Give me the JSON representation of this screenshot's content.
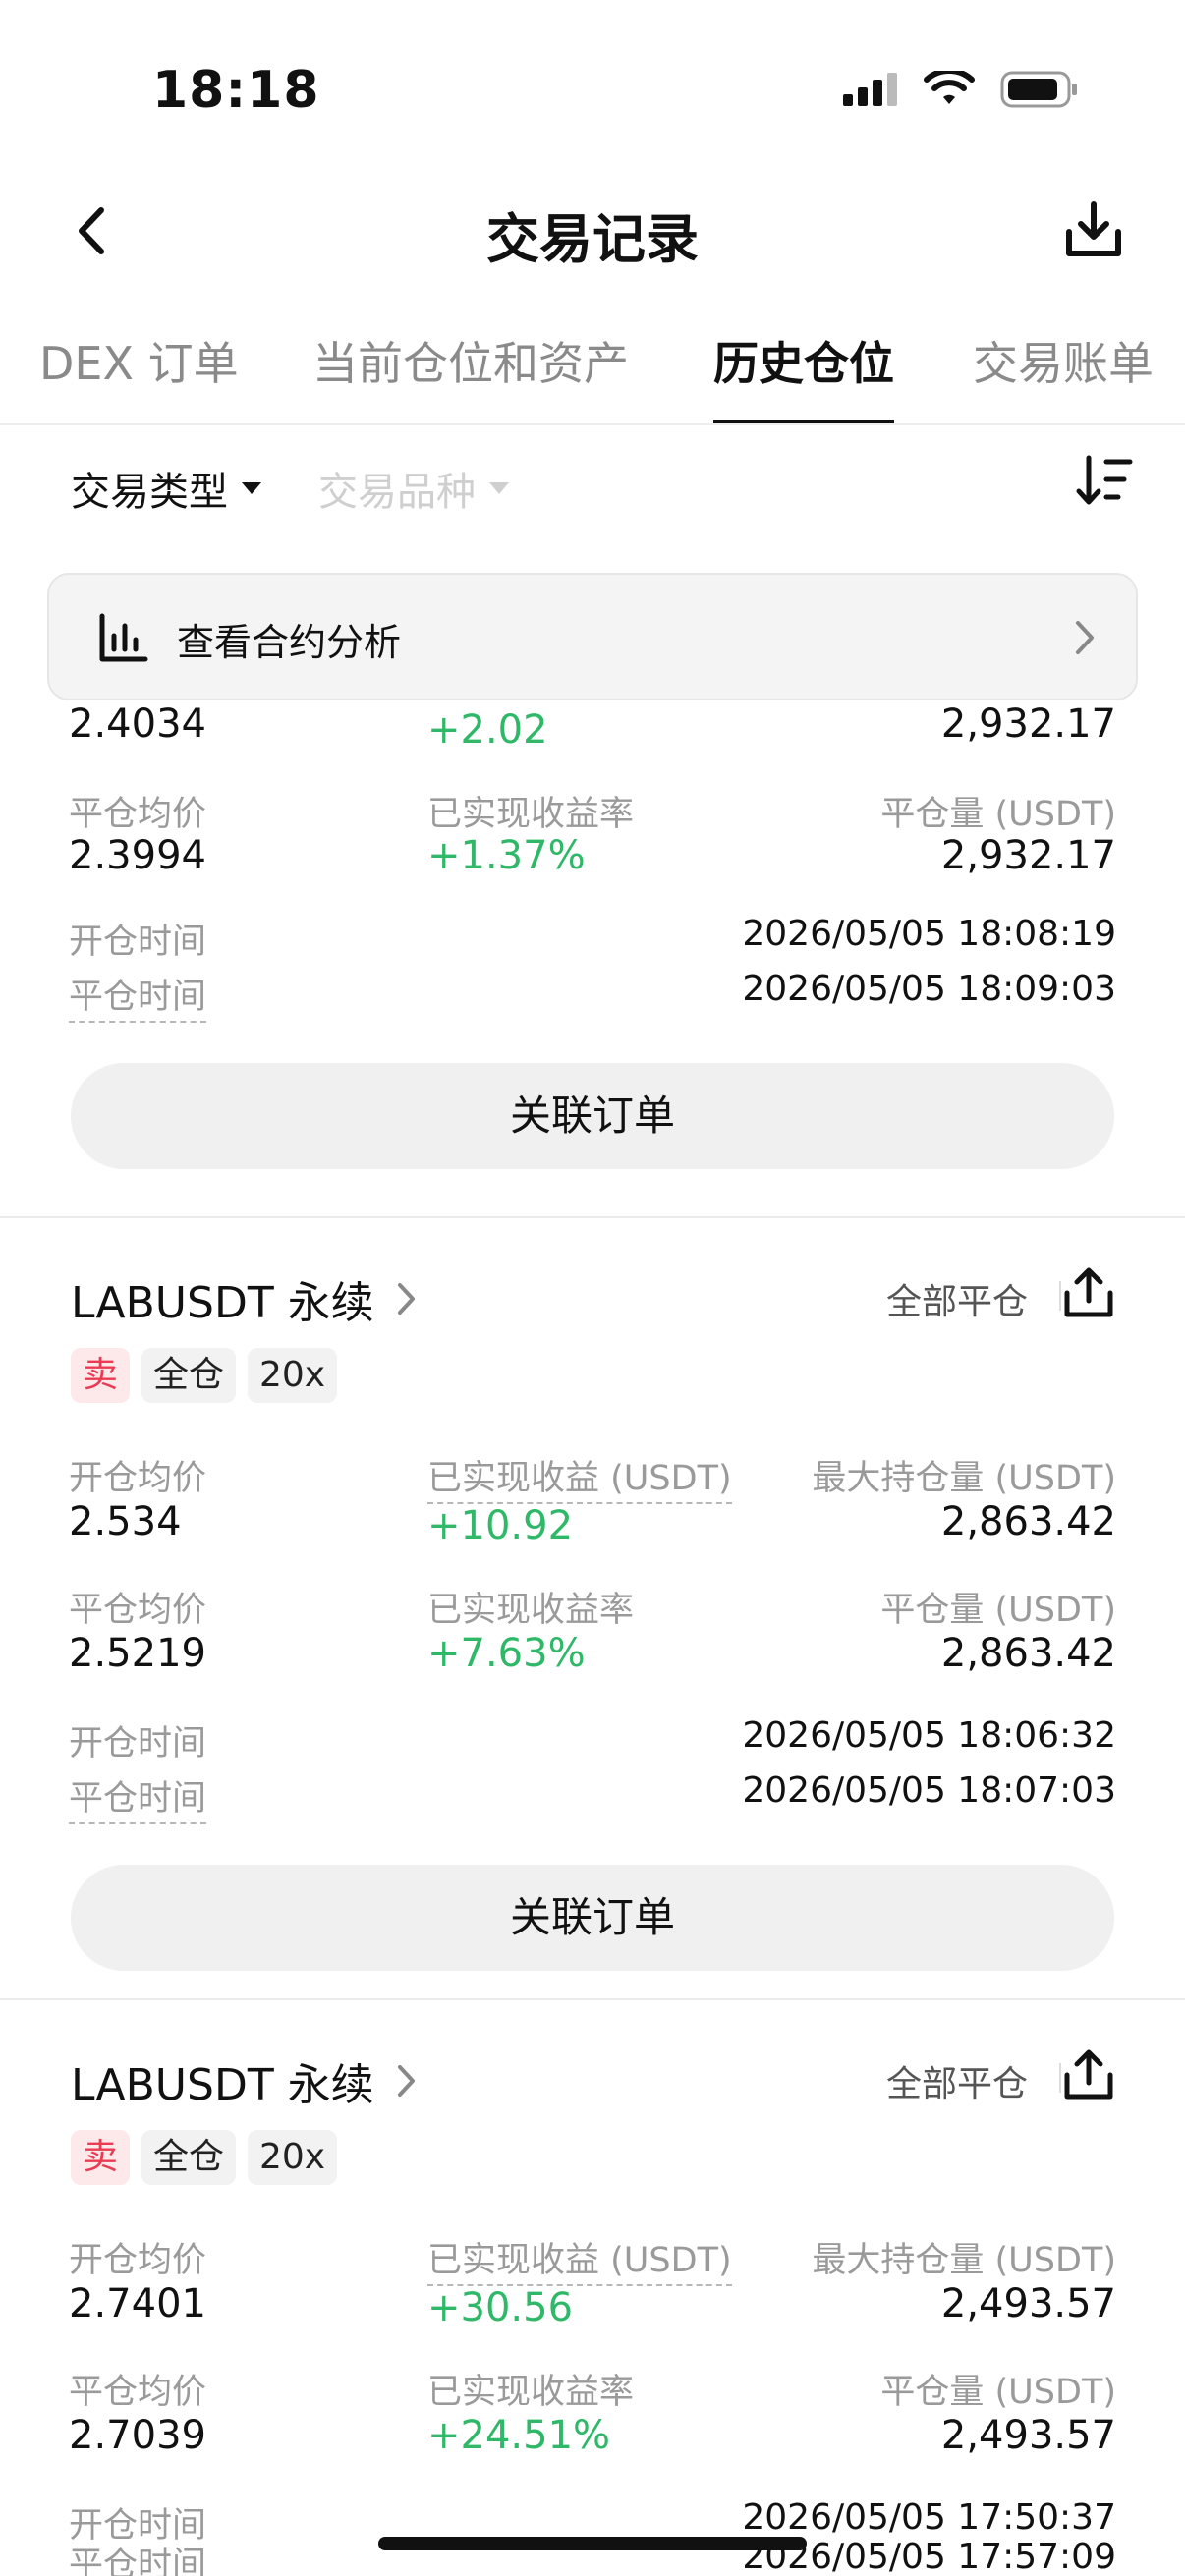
{
  "status_bar": {
    "time": "18:18"
  },
  "header": {
    "title": "交易记录"
  },
  "tabs": [
    {
      "label": "DEX 订单"
    },
    {
      "label": "当前仓位和资产"
    },
    {
      "label": "历史仓位"
    },
    {
      "label": "交易账单"
    }
  ],
  "active_tab": "历史仓位",
  "filters": {
    "trade_type": "交易类型",
    "trade_symbol": "交易品种"
  },
  "analysis_banner": {
    "label": "查看合约分析"
  },
  "labels": {
    "open_avg": "开仓均价",
    "close_avg": "平仓均价",
    "realized_pnl": "已实现收益 (USDT)",
    "realized_rate": "已实现收益率",
    "max_position": "最大持仓量 (USDT)",
    "close_amount": "平仓量 (USDT)",
    "open_time": "开仓时间",
    "close_time": "平仓时间",
    "close_all": "全部平仓",
    "linked_orders": "关联订单"
  },
  "positions": [
    {
      "open_avg": "2.4034",
      "realized_pnl": "+2.02",
      "max_position": "2,932.17",
      "close_avg": "2.3994",
      "realized_rate": "+1.37%",
      "close_amount": "2,932.17",
      "open_time": "2026/05/05 18:08:19",
      "close_time": "2026/05/05 18:09:03"
    },
    {
      "symbol": "LABUSDT 永续",
      "side": "卖",
      "margin_mode": "全仓",
      "leverage": "20x",
      "open_avg": "2.534",
      "realized_pnl": "+10.92",
      "max_position": "2,863.42",
      "close_avg": "2.5219",
      "realized_rate": "+7.63%",
      "close_amount": "2,863.42",
      "open_time": "2026/05/05 18:06:32",
      "close_time": "2026/05/05 18:07:03"
    },
    {
      "symbol": "LABUSDT 永续",
      "side": "卖",
      "margin_mode": "全仓",
      "leverage": "20x",
      "open_avg": "2.7401",
      "realized_pnl": "+30.56",
      "max_position": "2,493.57",
      "close_avg": "2.7039",
      "realized_rate": "+24.51%",
      "close_amount": "2,493.57",
      "open_time": "2026/05/05 17:50:37",
      "close_time": "2026/05/05 17:57:09"
    }
  ],
  "colors": {
    "profit_green": "#2fb868",
    "sell_red": "#ea3b52",
    "sell_bg": "#fde8ea"
  },
  "icons": [
    "back-arrow-icon",
    "download-icon",
    "sort-icon",
    "bar-chart-icon",
    "chevron-right-icon",
    "share-icon",
    "signal-icon",
    "wifi-icon",
    "battery-icon"
  ]
}
